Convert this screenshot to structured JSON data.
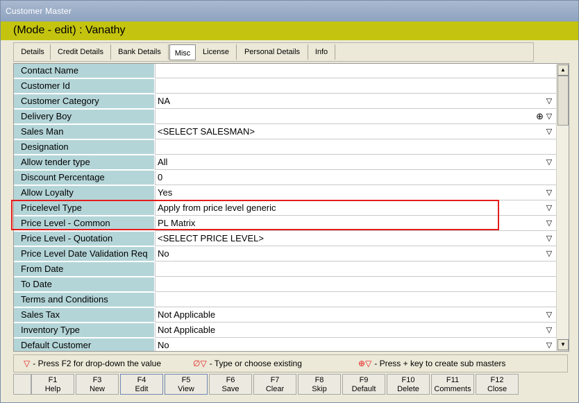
{
  "window": {
    "title": "Customer Master"
  },
  "mode": {
    "text": "(Mode - edit)  :  Vanathy"
  },
  "tabs": [
    {
      "label": "Details"
    },
    {
      "label": "Credit Details"
    },
    {
      "label": "Bank Details"
    },
    {
      "label": "Misc",
      "active": true
    },
    {
      "label": "License"
    },
    {
      "label": "Personal Details"
    },
    {
      "label": "Info"
    }
  ],
  "rows": [
    {
      "label": "Contact Name",
      "value": "",
      "dropdown": false
    },
    {
      "label": "Customer Id",
      "value": "",
      "dropdown": false
    },
    {
      "label": "Customer Category",
      "value": "NA",
      "dropdown": true
    },
    {
      "label": "Delivery Boy",
      "value": "",
      "dropdown": true,
      "addnew": true
    },
    {
      "label": "Sales Man",
      "value": "<SELECT SALESMAN>",
      "dropdown": true
    },
    {
      "label": "Designation",
      "value": "",
      "dropdown": false
    },
    {
      "label": "Allow tender type",
      "value": "All",
      "dropdown": true
    },
    {
      "label": "Discount Percentage",
      "value": "0",
      "dropdown": false
    },
    {
      "label": "Allow Loyalty",
      "value": "Yes",
      "dropdown": true
    },
    {
      "label": "Pricelevel Type",
      "value": "Apply from price level generic",
      "dropdown": true
    },
    {
      "label": "Price Level - Common",
      "value": "PL Matrix",
      "dropdown": true
    },
    {
      "label": "Price Level - Quotation",
      "value": "<SELECT PRICE LEVEL>",
      "dropdown": true
    },
    {
      "label": "Price Level Date Validation Req",
      "value": "No",
      "dropdown": true
    },
    {
      "label": "From Date",
      "value": "",
      "dropdown": false
    },
    {
      "label": "To Date",
      "value": "",
      "dropdown": false
    },
    {
      "label": "Terms and Conditions",
      "value": "",
      "dropdown": false
    },
    {
      "label": "Sales Tax",
      "value": "Not Applicable",
      "dropdown": true
    },
    {
      "label": "Inventory Type",
      "value": "Not Applicable",
      "dropdown": true
    },
    {
      "label": "Default Customer",
      "value": "No",
      "dropdown": true
    }
  ],
  "legend": [
    {
      "symbol": "▽",
      "text": "- Press F2 for drop-down the value"
    },
    {
      "symbol": "∅▽",
      "text": "- Type or choose existing"
    },
    {
      "symbol": "⊕▽",
      "text": "- Press + key to create sub masters"
    }
  ],
  "function_keys": [
    {
      "key": "F1",
      "label": "Help"
    },
    {
      "key": "F3",
      "label": "New"
    },
    {
      "key": "F4",
      "label": "Edit"
    },
    {
      "key": "F5",
      "label": "View"
    },
    {
      "key": "F6",
      "label": "Save"
    },
    {
      "key": "F7",
      "label": "Clear"
    },
    {
      "key": "F8",
      "label": "Skip"
    },
    {
      "key": "F9",
      "label": "Default"
    },
    {
      "key": "F10",
      "label": "Delete"
    },
    {
      "key": "F11",
      "label": "Comments"
    },
    {
      "key": "F12",
      "label": "Close"
    }
  ],
  "colors": {
    "highlight": "#e51c1c",
    "label_bg": "#b4d5d8",
    "mode_bar": "#c4c410"
  }
}
